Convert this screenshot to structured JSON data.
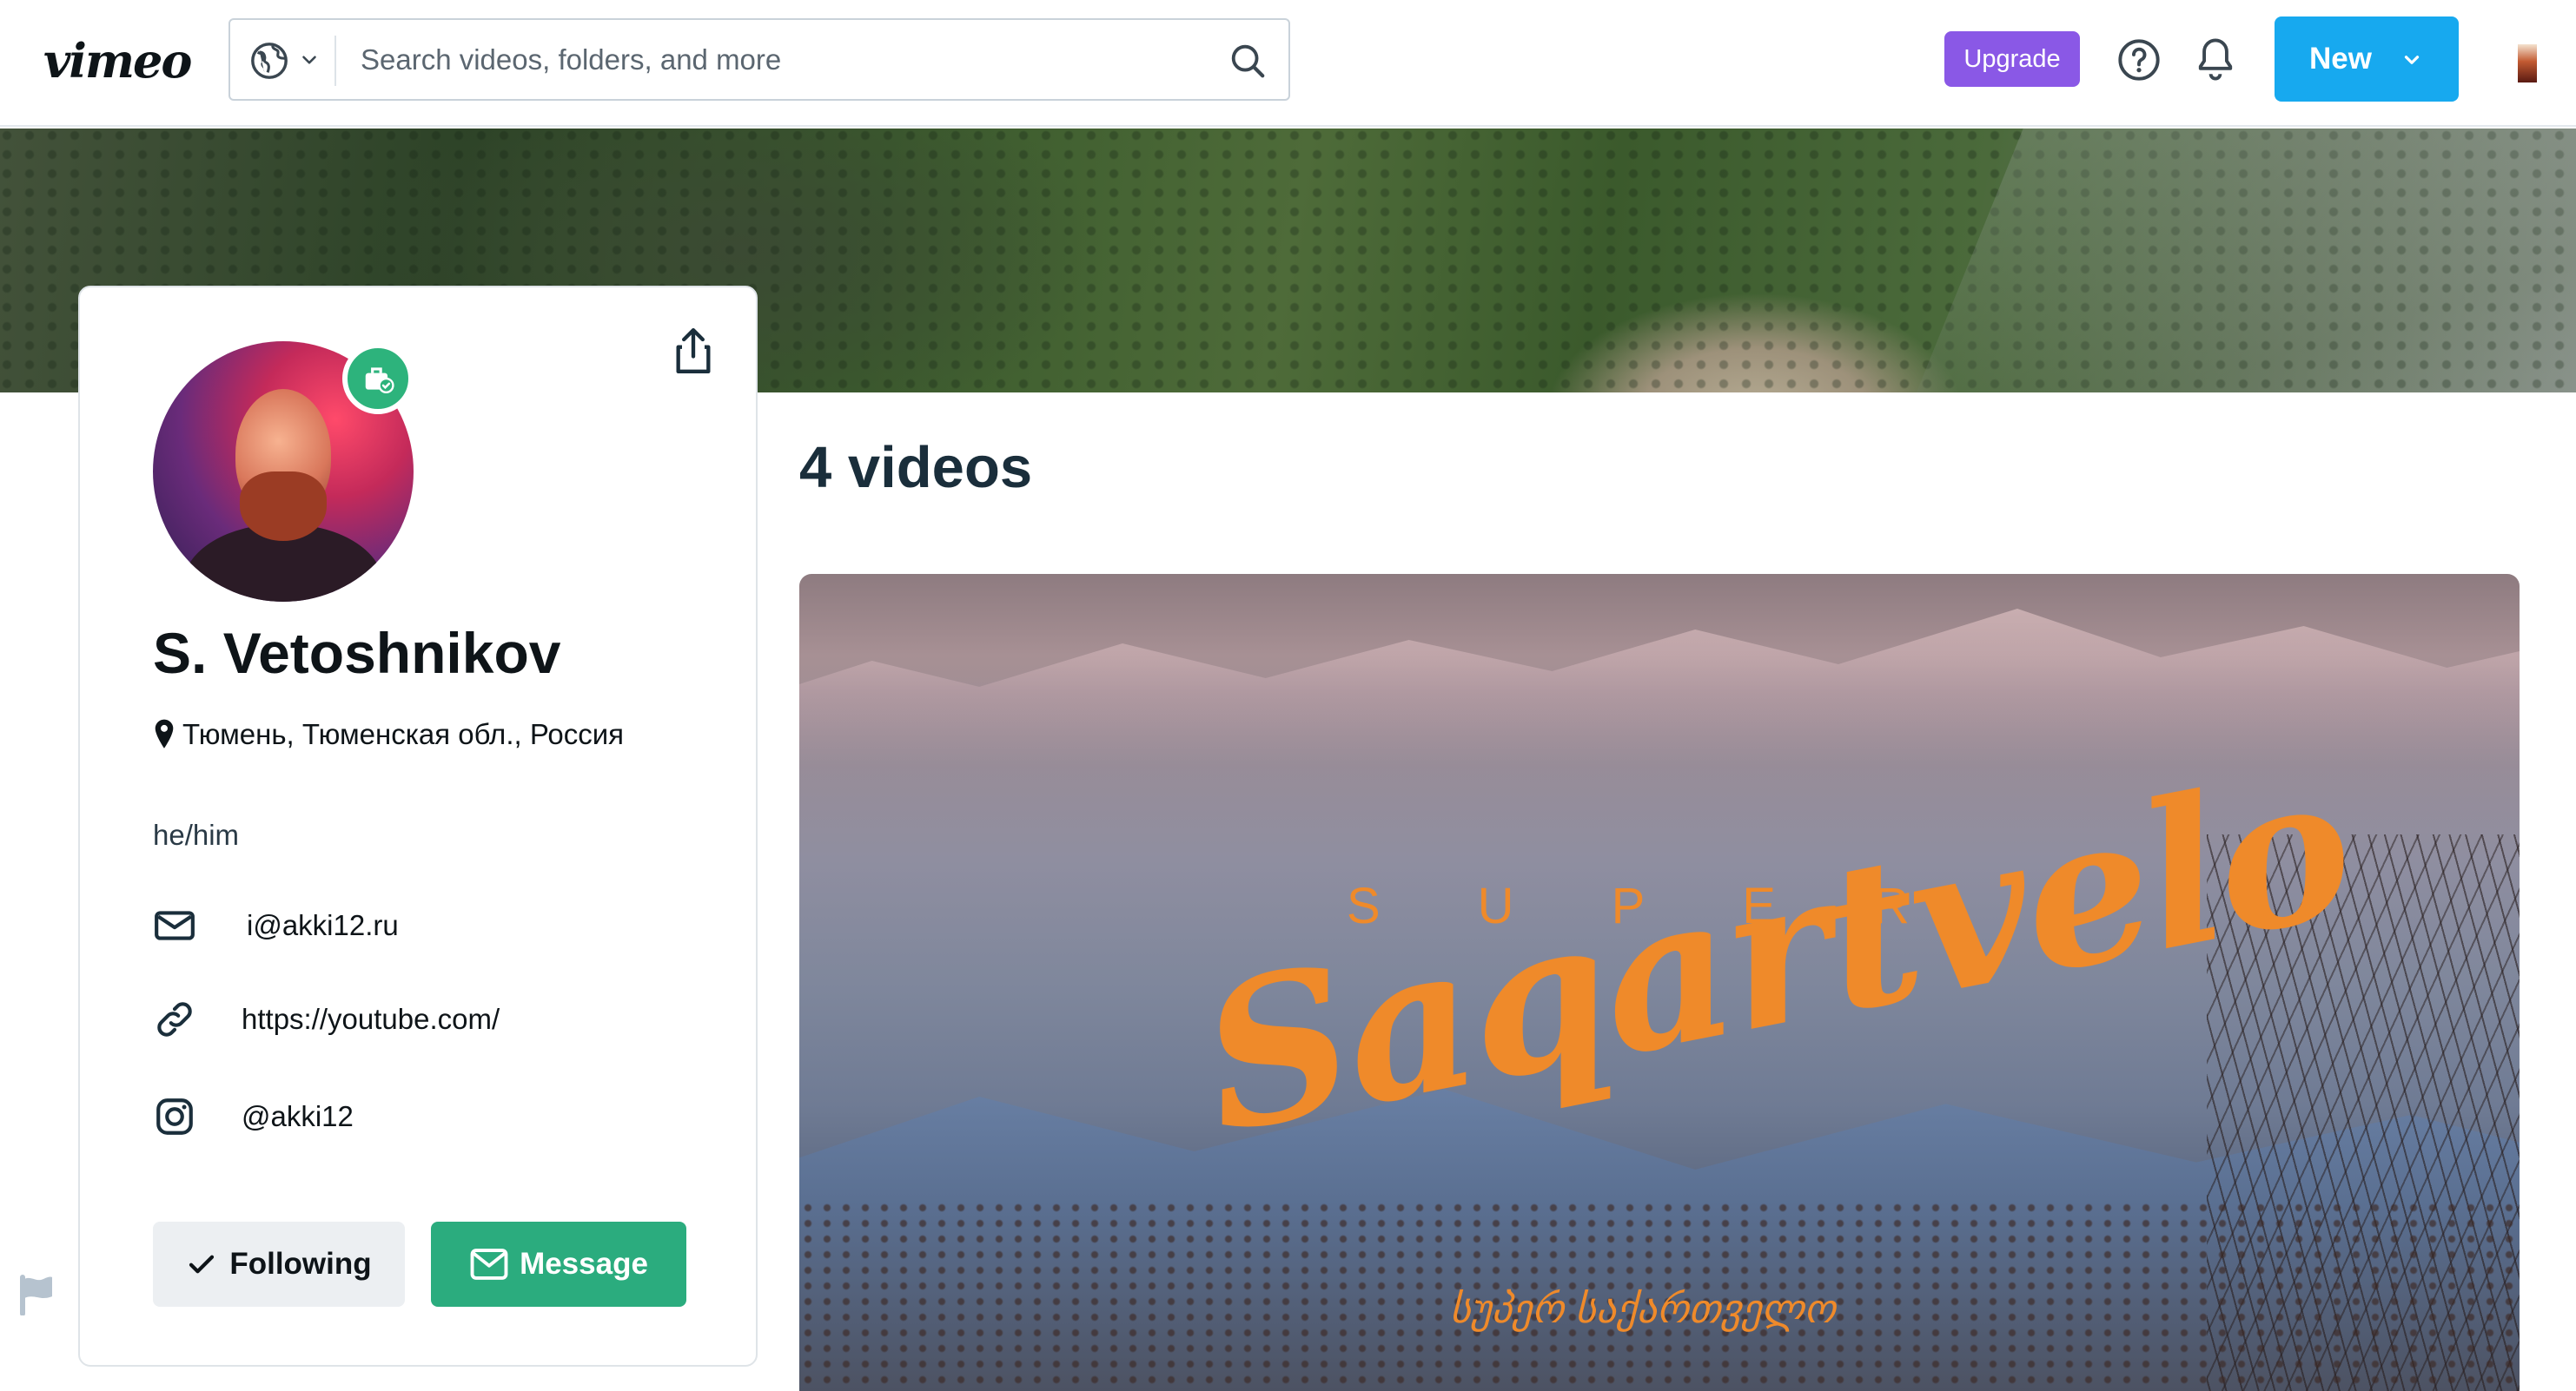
{
  "header": {
    "logo": "vimeo",
    "search_placeholder": "Search videos, folders, and more",
    "upgrade_label": "Upgrade",
    "new_label": "New"
  },
  "profile": {
    "name": "S. Vetoshnikov",
    "location": "Тюмень, Тюменская обл., Россия",
    "pronouns": "he/him",
    "email": "i@akki12.ru",
    "website": "https://youtube.com/",
    "instagram": "@akki12",
    "following_label": "Following",
    "message_label": "Message"
  },
  "main": {
    "video_count": "4 videos",
    "featured_video": {
      "title_top": "SUPER",
      "title_script": "Saqartvelo",
      "title_georgian": "სუპერ საქართველო"
    }
  },
  "colors": {
    "upgrade": "#8a58e6",
    "new_button": "#17a9ef",
    "message_button": "#2bac7e",
    "title_orange": "#ef8a2a"
  }
}
